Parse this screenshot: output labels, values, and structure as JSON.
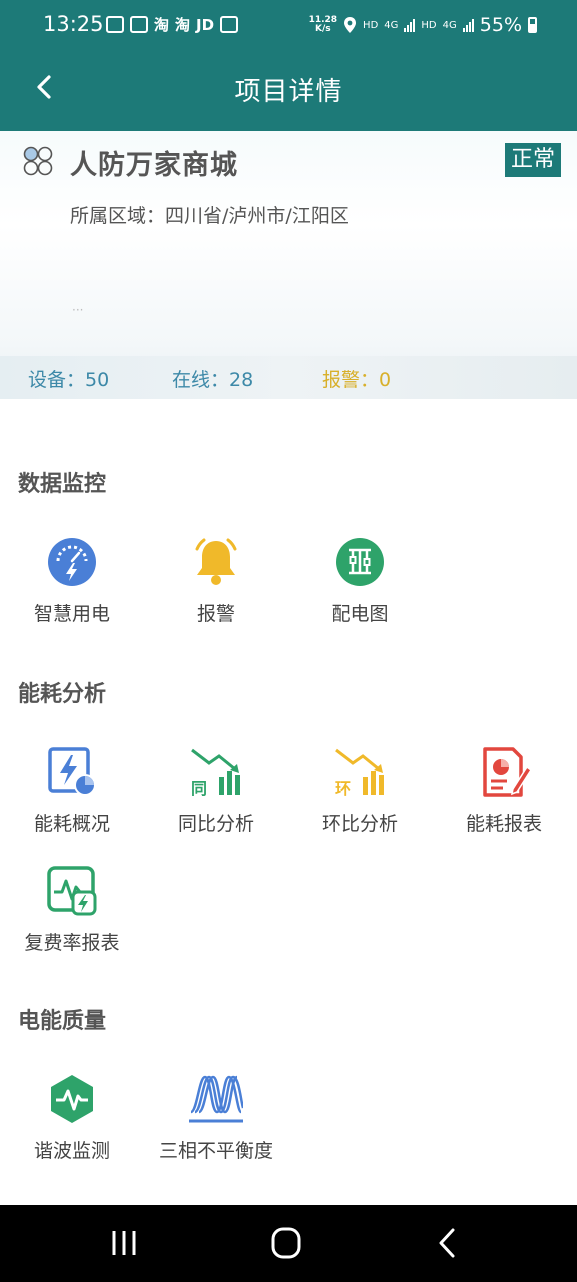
{
  "status_bar": {
    "time": "13:25",
    "app_icons": [
      "淘",
      "淘",
      "JD"
    ],
    "speed_value": "11.28",
    "speed_unit": "K/s",
    "hd1": "HD",
    "net1": "4G",
    "hd2": "HD",
    "net2": "4G",
    "battery": "55%"
  },
  "header": {
    "title": "项目详情"
  },
  "project": {
    "name": "人防万家商城",
    "status": "正常",
    "region_label": "所属区域：",
    "region_value": "四川省/泸州市/江阳区",
    "dots": "···",
    "devices": "设备：50",
    "online": "在线：28",
    "alarm": "报警：0"
  },
  "sections": {
    "monitoring": {
      "title": "数据监控",
      "items": [
        {
          "label": "智慧用电",
          "icon": "smart-power-icon"
        },
        {
          "label": "报警",
          "icon": "bell-icon"
        },
        {
          "label": "配电图",
          "icon": "distribution-diagram-icon"
        }
      ]
    },
    "energy": {
      "title": "能耗分析",
      "items": [
        {
          "label": "能耗概况",
          "icon": "energy-overview-icon"
        },
        {
          "label": "同比分析",
          "icon": "yoy-analysis-icon",
          "badge": "同"
        },
        {
          "label": "环比分析",
          "icon": "mom-analysis-icon",
          "badge": "环"
        },
        {
          "label": "能耗报表",
          "icon": "energy-report-icon"
        },
        {
          "label": "复费率报表",
          "icon": "tariff-report-icon"
        }
      ]
    },
    "quality": {
      "title": "电能质量",
      "items": [
        {
          "label": "谐波监测",
          "icon": "harmonic-monitor-icon"
        },
        {
          "label": "三相不平衡度",
          "icon": "three-phase-wave-icon"
        }
      ]
    }
  },
  "colors": {
    "header_bg": "#1d7a78",
    "stat_blue": "#3d89a8",
    "stat_alarm": "#d8b02b",
    "icon_blue": "#4a7fd6",
    "icon_yellow": "#f0b92a",
    "icon_green": "#2ea36a",
    "icon_red": "#e2473e"
  }
}
